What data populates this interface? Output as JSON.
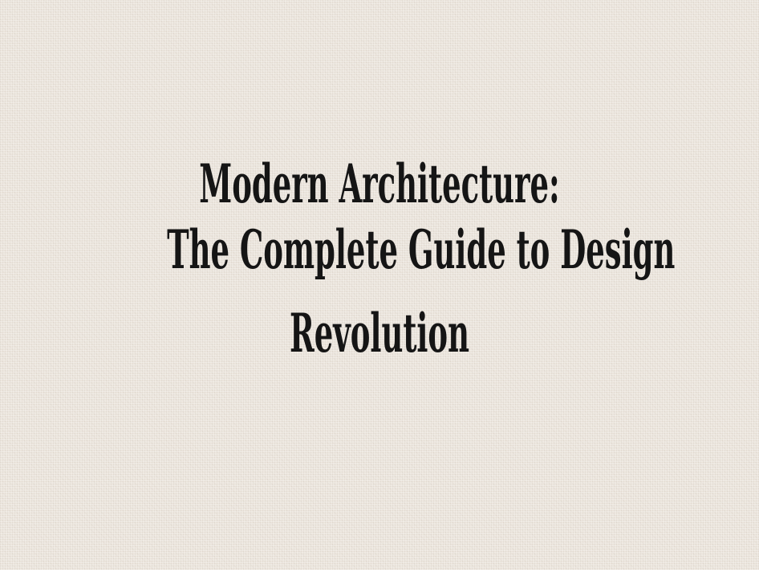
{
  "cover": {
    "title_line_1": "Modern Architecture:",
    "title_line_2": "The Complete Guide to Design",
    "title_line_3": "Revolution"
  },
  "colors": {
    "background": "#ece6de",
    "text": "#151515"
  }
}
